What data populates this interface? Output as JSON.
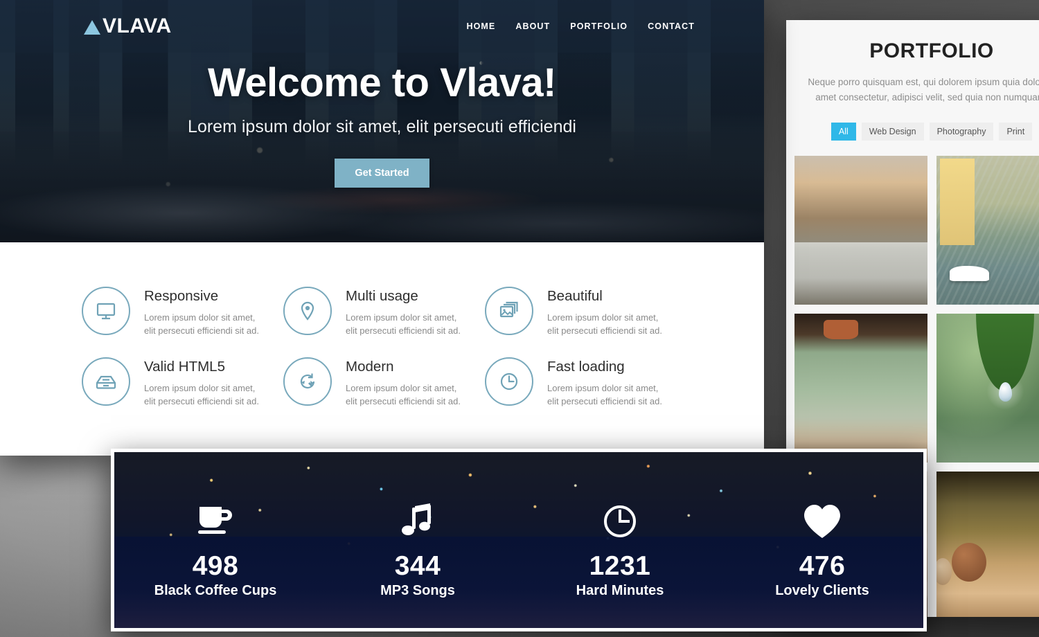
{
  "theme": {
    "accent_blue": "#7fb2c6",
    "icon_blue": "#6fa2b6",
    "filter_active": "#2fb8e8",
    "logo_triangle": "#8cc6e0"
  },
  "main_page": {
    "navbar": {
      "logo_text": "VLAVA",
      "logo_icon": "triangle-logo-icon",
      "links": [
        {
          "label": "HOME"
        },
        {
          "label": "ABOUT"
        },
        {
          "label": "PORTFOLIO"
        },
        {
          "label": "CONTACT"
        }
      ]
    },
    "hero": {
      "title": "Welcome to Vlava!",
      "subtitle": "Lorem ipsum dolor sit amet, elit persecuti efficiendi",
      "button_label": "Get Started"
    },
    "features": [
      {
        "icon": "monitor-icon",
        "title": "Responsive",
        "text": "Lorem ipsum dolor sit amet, elit persecuti efficiendi sit ad."
      },
      {
        "icon": "map-pin-icon",
        "title": "Multi usage",
        "text": "Lorem ipsum dolor sit amet, elit persecuti efficiendi sit ad."
      },
      {
        "icon": "images-icon",
        "title": "Beautiful",
        "text": "Lorem ipsum dolor sit amet, elit persecuti efficiendi sit ad."
      },
      {
        "icon": "drive-icon",
        "title": "Valid HTML5",
        "text": "Lorem ipsum dolor sit amet, elit persecuti efficiendi sit ad."
      },
      {
        "icon": "refresh-icon",
        "title": "Modern",
        "text": "Lorem ipsum dolor sit amet, elit persecuti efficiendi sit ad."
      },
      {
        "icon": "clock-icon",
        "title": "Fast loading",
        "text": "Lorem ipsum dolor sit amet, elit persecuti efficiendi sit ad."
      }
    ]
  },
  "portfolio_page": {
    "title": "PORTFOLIO",
    "description": "Neque porro quisquam est, qui dolorem ipsum quia dolor sit amet consectetur, adipisci velit, sed quia non numquam.",
    "filters": [
      {
        "label": "All",
        "active": true
      },
      {
        "label": "Web Design",
        "active": false
      },
      {
        "label": "Photography",
        "active": false
      },
      {
        "label": "Print",
        "active": false
      }
    ],
    "items": [
      {
        "name": "winter-field-photo"
      },
      {
        "name": "canal-boats-photo"
      },
      {
        "name": "garden-pots-photo"
      },
      {
        "name": "green-leaf-droplet-photo"
      },
      {
        "name": "painted-surface-photo"
      },
      {
        "name": "wooden-seed-pod-photo"
      }
    ]
  },
  "counters_page": {
    "items": [
      {
        "icon": "coffee-cup-icon",
        "number": "498",
        "label": "Black Coffee Cups"
      },
      {
        "icon": "music-note-icon",
        "number": "344",
        "label": "MP3 Songs"
      },
      {
        "icon": "clock-icon",
        "number": "1231",
        "label": "Hard Minutes"
      },
      {
        "icon": "heart-icon",
        "number": "476",
        "label": "Lovely Clients"
      }
    ]
  }
}
